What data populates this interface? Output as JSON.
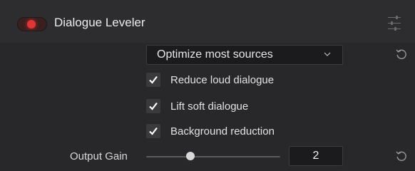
{
  "panel": {
    "title": "Dialogue Leveler",
    "enabled": true,
    "accent_color": "#e23636",
    "menu_icon": "options-sliders-icon"
  },
  "mode_dropdown": {
    "selected": "Optimize most sources",
    "icon": "chevron-down-icon"
  },
  "options": [
    {
      "label": "Reduce loud dialogue",
      "checked": true
    },
    {
      "label": "Lift soft dialogue",
      "checked": true
    },
    {
      "label": "Background reduction",
      "checked": true
    }
  ],
  "output_gain": {
    "label": "Output Gain",
    "value": "2",
    "slider_fraction": 0.33
  },
  "reset_icon": "reset-icon"
}
